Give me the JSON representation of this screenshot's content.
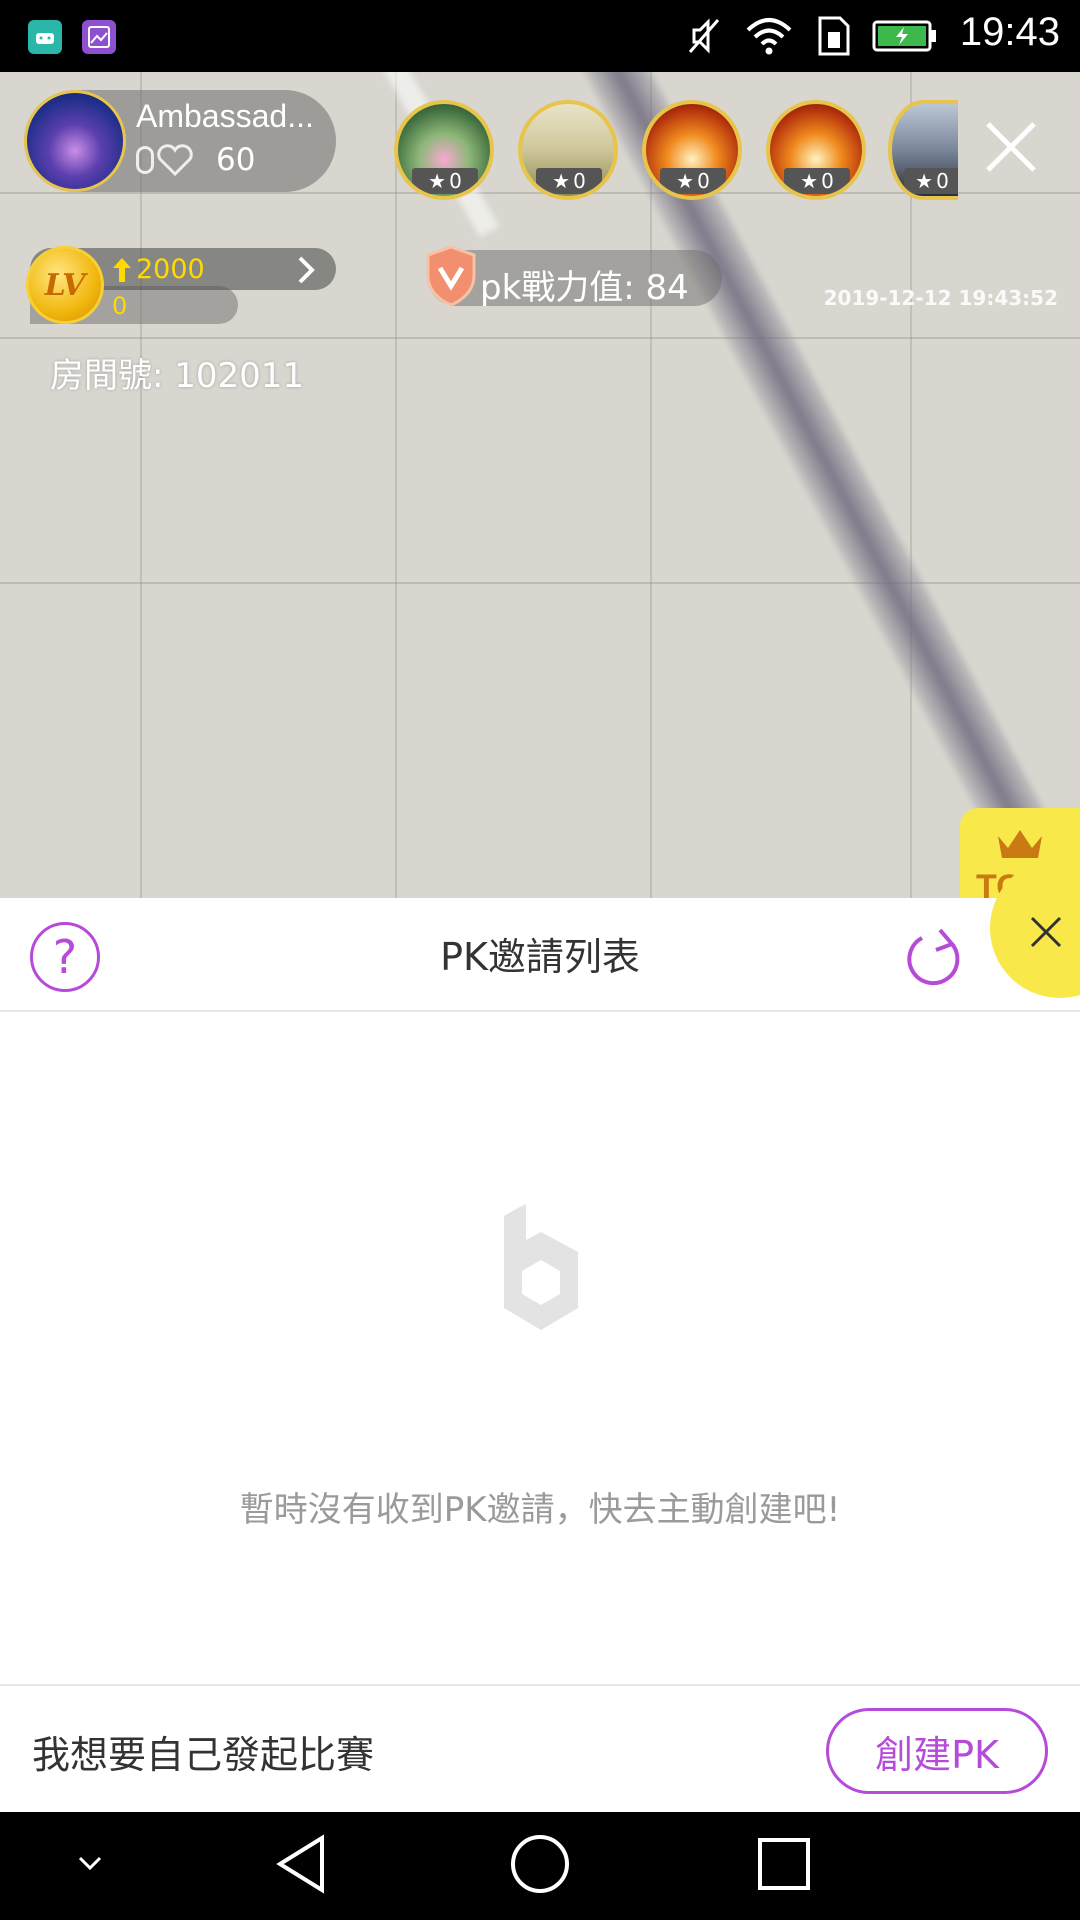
{
  "status_bar": {
    "time": "19:43",
    "icons": [
      "android-icon",
      "gallery-icon",
      "mute-icon",
      "wifi-icon",
      "sim-icon",
      "battery-charging-icon"
    ]
  },
  "host": {
    "name": "Ambassad...",
    "badge_value": "0",
    "likes": "60"
  },
  "viewers": [
    {
      "score": "0",
      "avatar": "lotus"
    },
    {
      "score": "0",
      "avatar": "grass"
    },
    {
      "score": "0",
      "avatar": "butterfly"
    },
    {
      "score": "0",
      "avatar": "butterfly"
    },
    {
      "score": "0",
      "avatar": "city"
    }
  ],
  "level": {
    "coin_label": "LV",
    "up_value": "2000",
    "current": "0"
  },
  "pk_power": {
    "label": "pk戰力值: 84"
  },
  "timestamp": "2019-12-12 19:43:52",
  "room": {
    "label": "房間號: 102011"
  },
  "top_ribbon": {
    "label": "TOP"
  },
  "panel": {
    "help_label": "?",
    "title": "PK邀請列表",
    "empty_message": "暫時沒有收到PK邀請，快去主動創建吧!",
    "footer_label": "我想要自己發起比賽",
    "create_button": "創建PK"
  },
  "colors": {
    "accent": "#b64ad9",
    "gold": "#e7c54c",
    "yellow": "#f8e84a",
    "level_text": "#ffd900"
  }
}
